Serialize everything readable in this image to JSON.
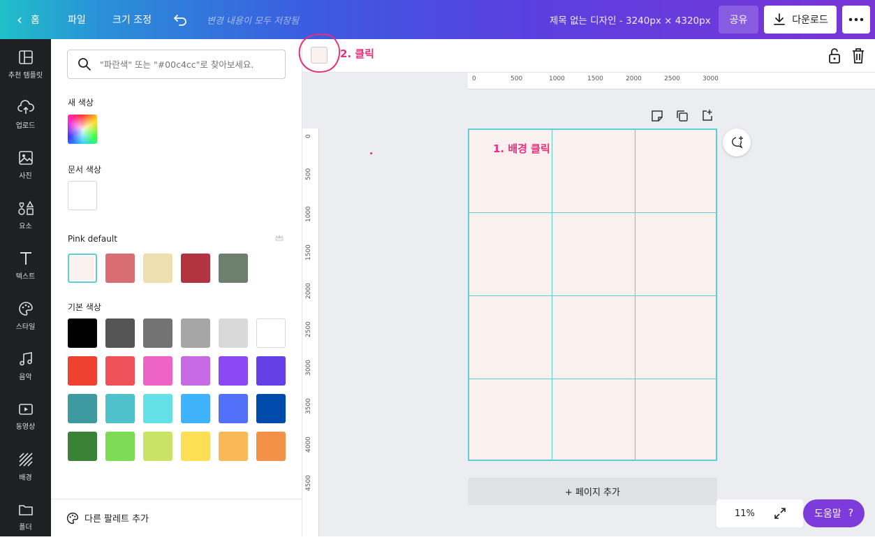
{
  "topbar": {
    "home_label": "홈",
    "file_label": "파일",
    "resize_label": "크기 조정",
    "saved_status": "변경 내용이 모두 저장됨",
    "doc_title": "제목 없는 디자인 - 3240px × 4320px",
    "share_label": "공유",
    "download_label": "다운로드"
  },
  "sidebar": {
    "items": [
      {
        "label": "추천 템플릿",
        "icon": "layout-icon"
      },
      {
        "label": "업로드",
        "icon": "upload-cloud-icon"
      },
      {
        "label": "사진",
        "icon": "photo-icon"
      },
      {
        "label": "요소",
        "icon": "elements-icon"
      },
      {
        "label": "텍스트",
        "icon": "text-icon"
      },
      {
        "label": "스타일",
        "icon": "palette-icon"
      },
      {
        "label": "음악",
        "icon": "music-icon"
      },
      {
        "label": "동영상",
        "icon": "video-icon"
      },
      {
        "label": "배경",
        "icon": "background-icon"
      },
      {
        "label": "폴더",
        "icon": "folder-icon"
      }
    ]
  },
  "panel": {
    "search_placeholder": "\"파란색\" 또는 \"#00c4cc\"로 찾아보세요.",
    "new_color_title": "새 색상",
    "doc_color_title": "문서 색상",
    "palette_title": "Pink default",
    "basic_title": "기본 색상",
    "add_palette_label": "다른 팔레트 추가",
    "doc_colors": [
      "#ffffff"
    ],
    "pink_palette": [
      "#faf1ee",
      "#d86d72",
      "#efdeb0",
      "#b2343f",
      "#6e806e"
    ],
    "basic_colors": [
      [
        "#000000",
        "#545454",
        "#737373",
        "#a6a6a6",
        "#d9d9d9",
        "#ffffff"
      ],
      [
        "#ee4130",
        "#ee5258",
        "#ee63c6",
        "#c869e5",
        "#8c49f3",
        "#6441e7"
      ],
      [
        "#3d9aa0",
        "#4fc1ca",
        "#63e0e8",
        "#3eb2fa",
        "#5271f8",
        "#004aac"
      ],
      [
        "#3a8336",
        "#7edb55",
        "#c9e366",
        "#fddf55",
        "#f9b957",
        "#f39149"
      ]
    ]
  },
  "toolbar": {
    "current_color": "#faf1ee",
    "annotation_2": "2. 클릭"
  },
  "canvas": {
    "annotation_1": "1. 배경 클릭",
    "add_page_label": "+ 페이지 추가",
    "zoom_label": "11%",
    "help_label": "도움말",
    "help_icon": "?",
    "ruler_top": [
      "0",
      "500",
      "1000",
      "1500",
      "2000",
      "2500",
      "3000"
    ],
    "ruler_left": [
      "0",
      "500",
      "1000",
      "1500",
      "2000",
      "2500",
      "3000",
      "3500",
      "4000",
      "4500"
    ]
  },
  "colors": {
    "accent_cyan": "#5ccfd6",
    "annotation_pink": "#ea2e7a",
    "help_purple": "#7d3bdc"
  }
}
